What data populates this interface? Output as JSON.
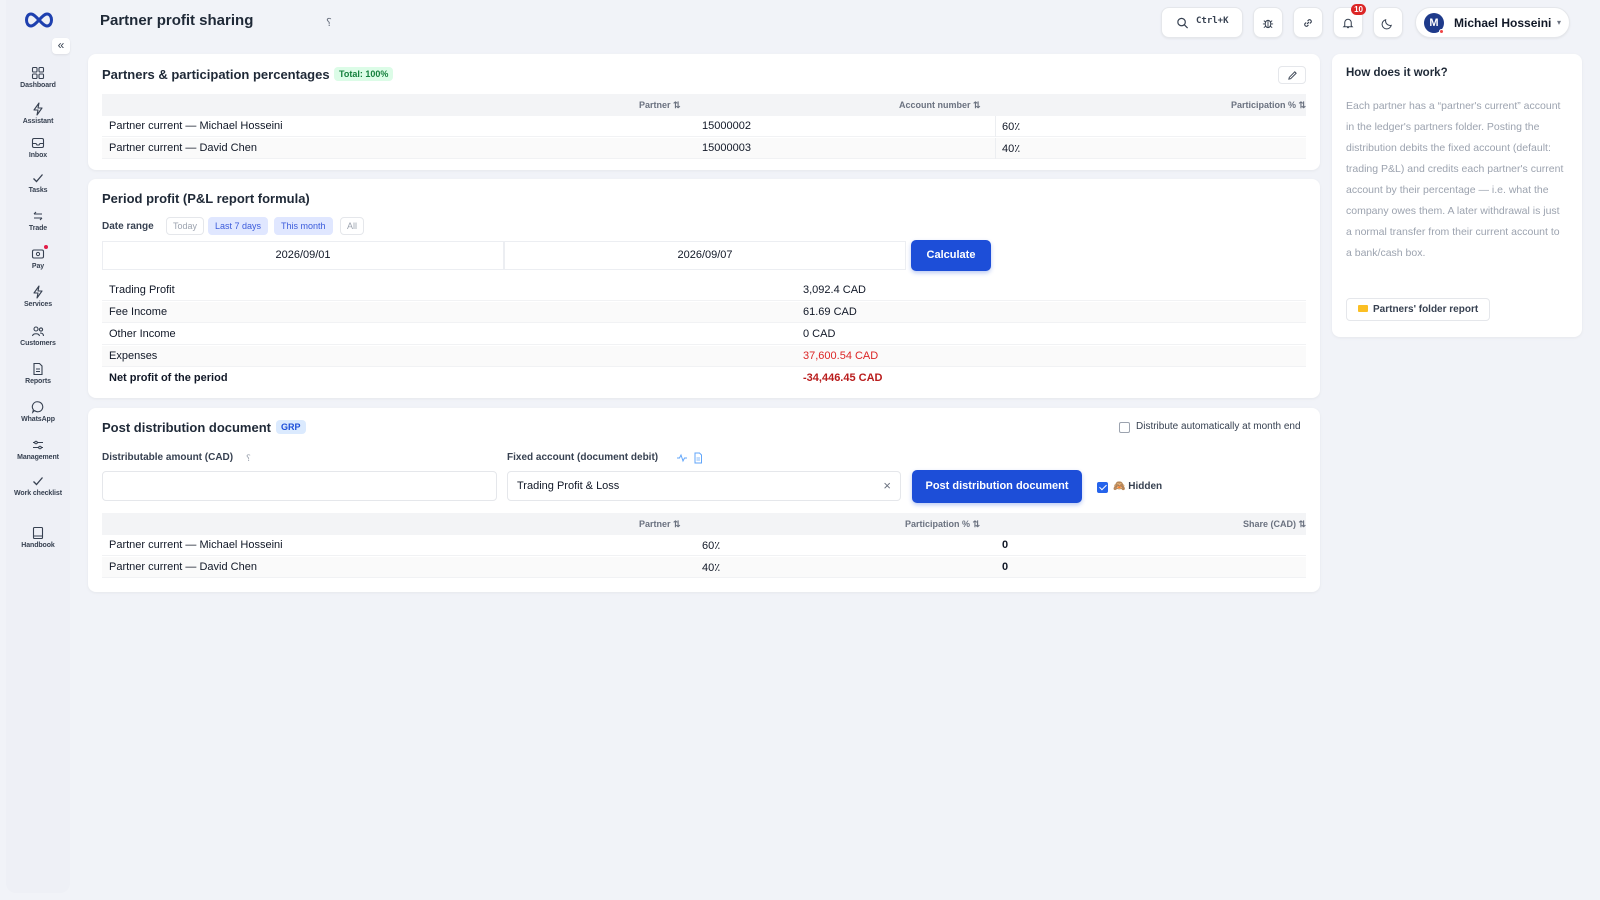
{
  "sidebar": {
    "collapse_icon": "«",
    "items": [
      {
        "label": "Dashboard",
        "icon": "dashboard-icon"
      },
      {
        "label": "Assistant",
        "icon": "bolt-icon"
      },
      {
        "label": "Inbox",
        "icon": "inbox-icon"
      },
      {
        "label": "Tasks",
        "icon": "check-icon"
      },
      {
        "label": "Trade",
        "icon": "swap-icon"
      },
      {
        "label": "Pay",
        "icon": "wallet-icon"
      },
      {
        "label": "Services",
        "icon": "bolt-icon"
      },
      {
        "label": "Customers",
        "icon": "users-icon"
      },
      {
        "label": "Reports",
        "icon": "file-icon"
      },
      {
        "label": "WhatsApp",
        "icon": "chat-icon"
      },
      {
        "label": "Management",
        "icon": "sliders-icon"
      },
      {
        "label": "Work checklist",
        "icon": "check-icon"
      },
      {
        "label": "Handbook",
        "icon": "book-icon"
      }
    ]
  },
  "header": {
    "title": "Partner profit sharing",
    "title_hint": "؟",
    "search_shortcut": "Ctrl+K",
    "notifications_count": "10",
    "user": {
      "initial": "M",
      "name": "Michael Hosseini",
      "caret": "▾"
    }
  },
  "partners": {
    "title": "Partners & participation percentages",
    "total_badge": "Total: 100%",
    "columns": [
      "Partner ⇅",
      "Account number ⇅",
      "Participation % ⇅"
    ],
    "rows": [
      {
        "partner": "Partner current — Michael Hosseini",
        "account": "15000002",
        "pct": "60٪"
      },
      {
        "partner": "Partner current — David Chen",
        "account": "15000003",
        "pct": "40٪"
      }
    ]
  },
  "period": {
    "title": "Period profit (P&L report formula)",
    "date_range_label": "Date range",
    "chips": [
      "Today",
      "Last 7 days",
      "This month",
      "All"
    ],
    "date_from": "2026/09/01",
    "date_to": "2026/09/07",
    "calculate_label": "Calculate",
    "rows": [
      {
        "label": "Trading Profit",
        "value": "3,092.4 CAD"
      },
      {
        "label": "Fee Income",
        "value": "61.69 CAD"
      },
      {
        "label": "Other Income",
        "value": "0 CAD"
      },
      {
        "label": "Expenses",
        "value": "37,600.54 CAD"
      },
      {
        "label": "Net profit of the period",
        "value": "-34,446.45 CAD"
      }
    ]
  },
  "distribution": {
    "title": "Post distribution document",
    "badge": "GRP",
    "auto_label": "Distribute automatically at month end",
    "amount_label": "Distributable amount (CAD)",
    "amount_hint": "؟",
    "amount_value": "",
    "fixed_account_label": "Fixed account (document debit)",
    "fixed_account_value": "Trading Profit & Loss",
    "clear_icon": "×",
    "post_label": "Post distribution document",
    "hidden_label": "🙈 Hidden",
    "columns": [
      "Partner ⇅",
      "Participation % ⇅",
      "Share (CAD) ⇅"
    ],
    "rows": [
      {
        "partner": "Partner current — Michael Hosseini",
        "pct": "60٪",
        "share": "0"
      },
      {
        "partner": "Partner current — David Chen",
        "pct": "40٪",
        "share": "0"
      }
    ]
  },
  "help": {
    "title": "How does it work?",
    "body": "Each partner has a “partner's current” account in the ledger's partners folder. Posting the distribution debits the fixed account (default: trading P&L) and credits each partner's current account by their percentage — i.e. what the company owes them. A later withdrawal is just a normal transfer from their current account to a bank/cash box.",
    "report_button": "Partners' folder report"
  },
  "colors": {
    "accent": "#1d4ed8",
    "negative": "#dc2626",
    "positive_badge": "#15803d"
  }
}
